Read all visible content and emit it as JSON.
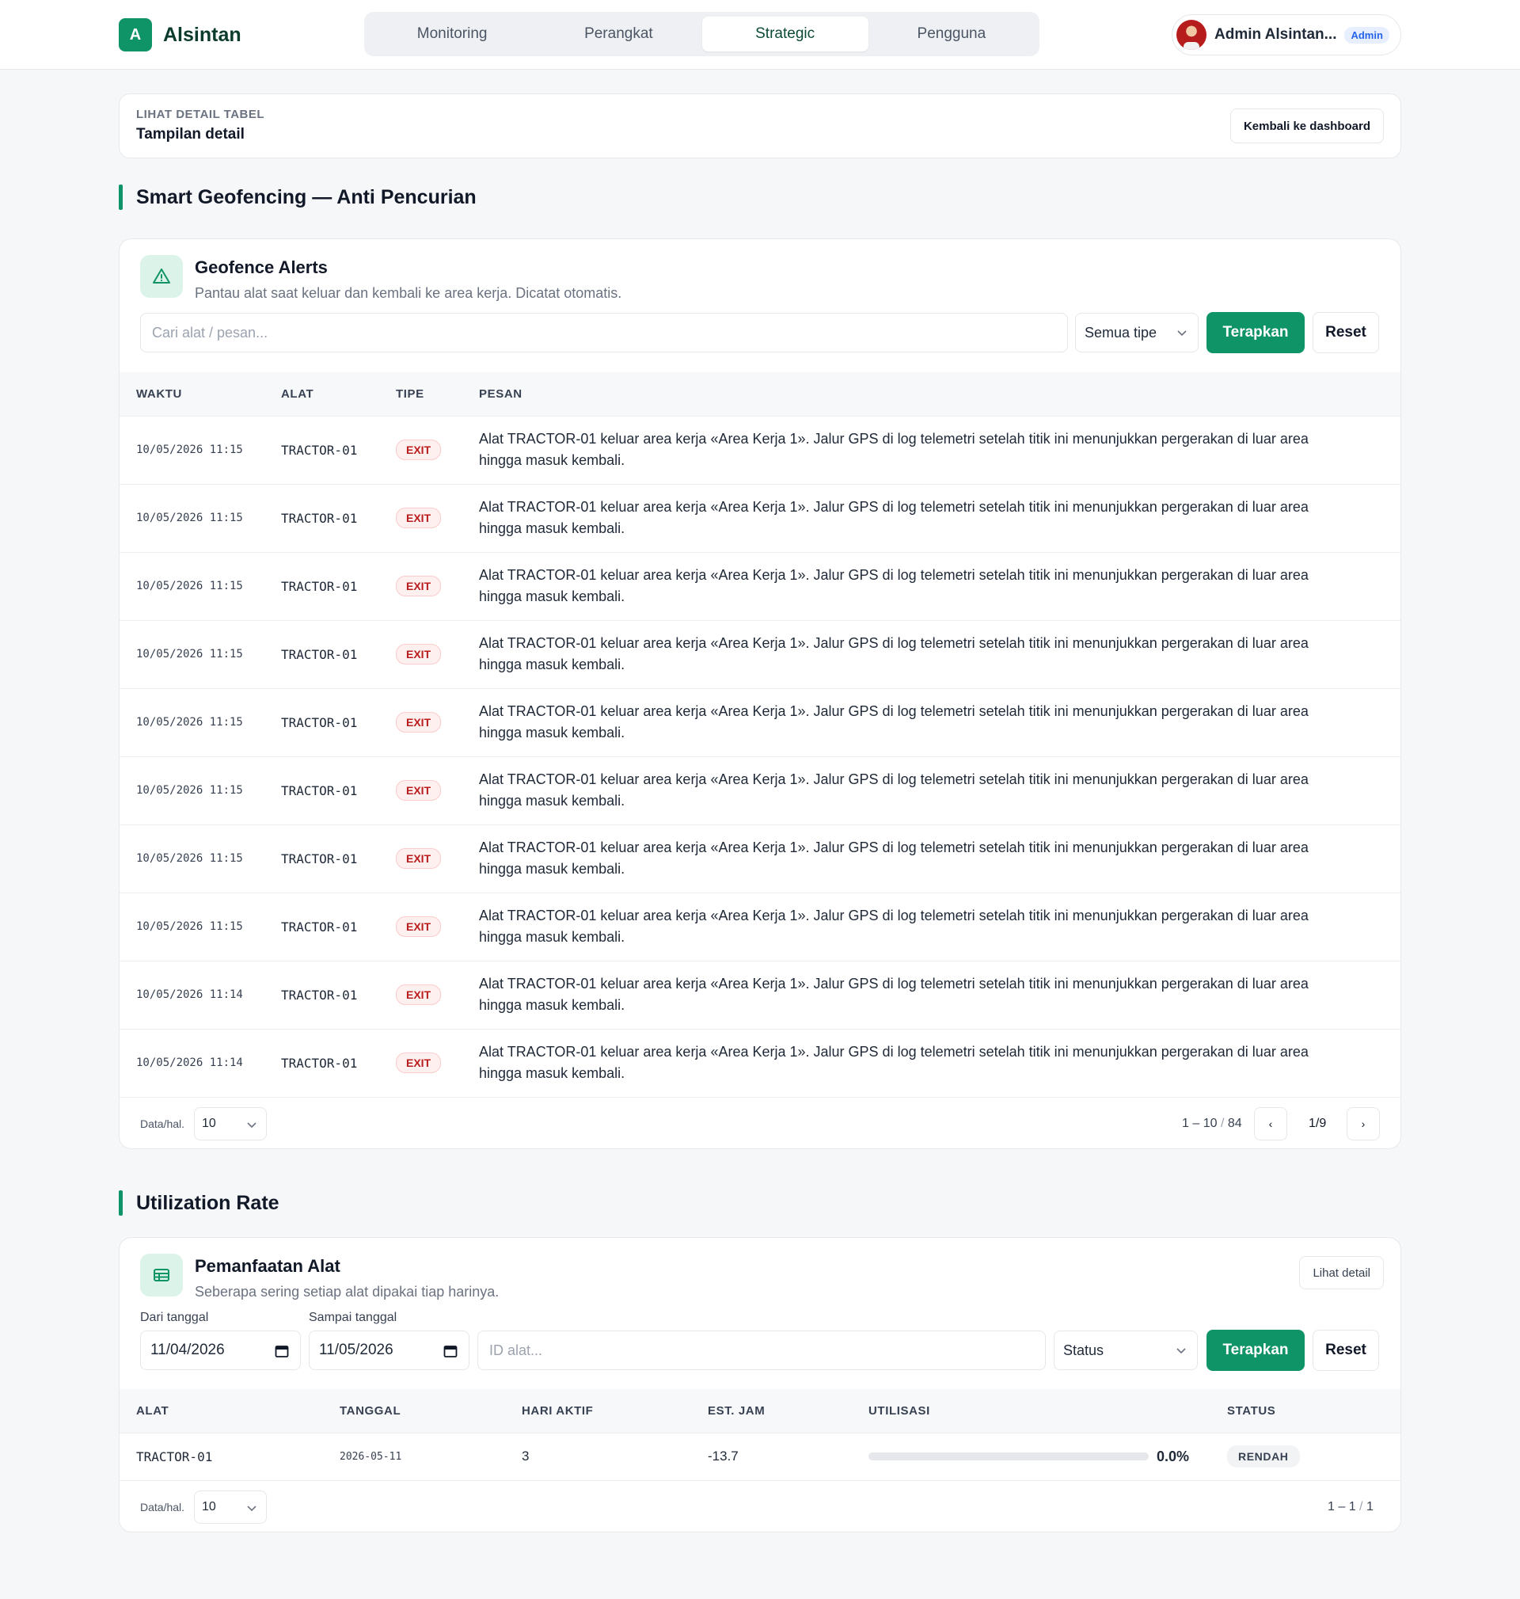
{
  "app": {
    "logo_letter": "A",
    "name": "Alsintan"
  },
  "nav": {
    "tabs": [
      "Monitoring",
      "Perangkat",
      "Strategic",
      "Pengguna"
    ],
    "active": "Strategic"
  },
  "user": {
    "name": "Admin Alsintan...",
    "role": "Admin"
  },
  "detail": {
    "kicker": "LIHAT DETAIL TABEL",
    "title": "Tampilan detail",
    "back_label": "Kembali ke dashboard"
  },
  "geofence": {
    "section_title": "Smart Geofencing — Anti Pencurian",
    "card_title": "Geofence Alerts",
    "card_subtitle": "Pantau alat saat keluar dan kembali ke area kerja. Dicatat otomatis.",
    "search_placeholder": "Cari alat / pesan...",
    "type_select": "Semua tipe",
    "apply_label": "Terapkan",
    "reset_label": "Reset",
    "columns": [
      "WAKTU",
      "ALAT",
      "TIPE",
      "PESAN"
    ],
    "rows": [
      {
        "time": "10/05/2026 11:15",
        "tool": "TRACTOR-01",
        "type": "EXIT",
        "message": "Alat TRACTOR-01 keluar area kerja «Area Kerja 1». Jalur GPS di log telemetri setelah titik ini menunjukkan pergerakan di luar area hingga masuk kembali."
      },
      {
        "time": "10/05/2026 11:15",
        "tool": "TRACTOR-01",
        "type": "EXIT",
        "message": "Alat TRACTOR-01 keluar area kerja «Area Kerja 1». Jalur GPS di log telemetri setelah titik ini menunjukkan pergerakan di luar area hingga masuk kembali."
      },
      {
        "time": "10/05/2026 11:15",
        "tool": "TRACTOR-01",
        "type": "EXIT",
        "message": "Alat TRACTOR-01 keluar area kerja «Area Kerja 1». Jalur GPS di log telemetri setelah titik ini menunjukkan pergerakan di luar area hingga masuk kembali."
      },
      {
        "time": "10/05/2026 11:15",
        "tool": "TRACTOR-01",
        "type": "EXIT",
        "message": "Alat TRACTOR-01 keluar area kerja «Area Kerja 1». Jalur GPS di log telemetri setelah titik ini menunjukkan pergerakan di luar area hingga masuk kembali."
      },
      {
        "time": "10/05/2026 11:15",
        "tool": "TRACTOR-01",
        "type": "EXIT",
        "message": "Alat TRACTOR-01 keluar area kerja «Area Kerja 1». Jalur GPS di log telemetri setelah titik ini menunjukkan pergerakan di luar area hingga masuk kembali."
      },
      {
        "time": "10/05/2026 11:15",
        "tool": "TRACTOR-01",
        "type": "EXIT",
        "message": "Alat TRACTOR-01 keluar area kerja «Area Kerja 1». Jalur GPS di log telemetri setelah titik ini menunjukkan pergerakan di luar area hingga masuk kembali."
      },
      {
        "time": "10/05/2026 11:15",
        "tool": "TRACTOR-01",
        "type": "EXIT",
        "message": "Alat TRACTOR-01 keluar area kerja «Area Kerja 1». Jalur GPS di log telemetri setelah titik ini menunjukkan pergerakan di luar area hingga masuk kembali."
      },
      {
        "time": "10/05/2026 11:15",
        "tool": "TRACTOR-01",
        "type": "EXIT",
        "message": "Alat TRACTOR-01 keluar area kerja «Area Kerja 1». Jalur GPS di log telemetri setelah titik ini menunjukkan pergerakan di luar area hingga masuk kembali."
      },
      {
        "time": "10/05/2026 11:14",
        "tool": "TRACTOR-01",
        "type": "EXIT",
        "message": "Alat TRACTOR-01 keluar area kerja «Area Kerja 1». Jalur GPS di log telemetri setelah titik ini menunjukkan pergerakan di luar area hingga masuk kembali."
      },
      {
        "time": "10/05/2026 11:14",
        "tool": "TRACTOR-01",
        "type": "EXIT",
        "message": "Alat TRACTOR-01 keluar area kerja «Area Kerja 1». Jalur GPS di log telemetri setelah titik ini menunjukkan pergerakan di luar area hingga masuk kembali."
      }
    ],
    "pagination": {
      "per_page_label": "Data/hal.",
      "per_page": "10",
      "range": "1 – 10",
      "sep": "/",
      "total": "84",
      "page": "1/9",
      "prev": "‹",
      "next": "›"
    }
  },
  "utilization": {
    "section_title": "Utilization Rate",
    "card_title": "Pemanfaatan Alat",
    "card_subtitle": "Seberapa sering setiap alat dipakai tiap harinya.",
    "detail_label": "Lihat detail",
    "from_label": "Dari tanggal",
    "from_value": "11/04/2026",
    "to_label": "Sampai tanggal",
    "to_value": "11/05/2026",
    "id_placeholder": "ID alat...",
    "status_select": "Status",
    "apply_label": "Terapkan",
    "reset_label": "Reset",
    "columns": [
      "ALAT",
      "TANGGAL",
      "HARI AKTIF",
      "EST. JAM",
      "UTILISASI",
      "STATUS"
    ],
    "rows": [
      {
        "tool": "TRACTOR-01",
        "date": "2026-05-11",
        "active_days": "3",
        "est_hours": "-13.7",
        "utilization": "0.0%",
        "utilization_value": 0.0,
        "status": "RENDAH"
      }
    ],
    "pagination": {
      "per_page_label": "Data/hal.",
      "per_page": "10",
      "range": "1 – 1",
      "sep": "/",
      "total": "1"
    }
  },
  "colors": {
    "accent": "#0f9467",
    "exit_badge": "#b91c1c",
    "role_badge": "#2563eb"
  }
}
